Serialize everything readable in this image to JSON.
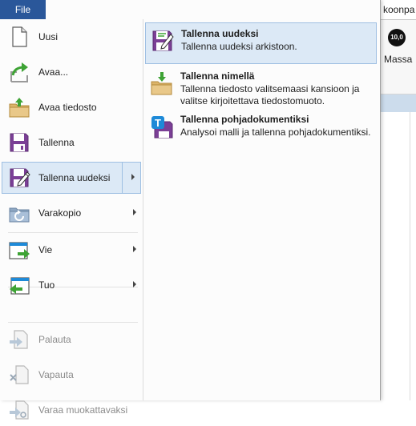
{
  "background_app": {
    "tab_partial": "koonpa",
    "ribbon_button_label": "Massa",
    "ribbon_button_icon_text": "10,0"
  },
  "file_tab": {
    "label": "File"
  },
  "menu": {
    "items": [
      {
        "label": "Uusi",
        "icon": "new-document-icon"
      },
      {
        "label": "Avaa...",
        "icon": "open-arrow-icon"
      },
      {
        "label": "Avaa tiedosto",
        "icon": "open-folder-icon"
      },
      {
        "label": "Tallenna",
        "icon": "save-disk-icon"
      },
      {
        "label": "Tallenna uudeksi",
        "icon": "save-as-new-icon",
        "selected": true,
        "has_submenu": true
      },
      {
        "label": "Varakopio",
        "icon": "backup-folder-icon",
        "has_submenu": true
      },
      {
        "label": "Vie",
        "icon": "export-icon",
        "has_submenu": true
      },
      {
        "label": "Tuo",
        "icon": "import-icon",
        "has_submenu": true
      },
      {
        "label": "Palauta",
        "icon": "restore-icon",
        "disabled": true
      },
      {
        "label": "Vapauta",
        "icon": "release-icon",
        "disabled": true
      },
      {
        "label": "Varaa muokattavaksi",
        "icon": "reserve-edit-icon",
        "disabled": true
      }
    ]
  },
  "submenu": {
    "items": [
      {
        "title": "Tallenna uudeksi",
        "description": "Tallenna uudeksi arkistoon.",
        "icon": "save-as-new-icon",
        "selected": true
      },
      {
        "title": "Tallenna nimellä",
        "description": "Tallenna tiedosto valitsemaasi kansioon ja valitse kirjoitettava tiedostomuoto.",
        "icon": "save-to-folder-icon"
      },
      {
        "title": "Tallenna pohjadokumentiksi",
        "description": "Analysoi malli ja tallenna pohjadokumentiksi.",
        "icon": "save-template-icon",
        "icon_letter": "T"
      }
    ]
  },
  "colors": {
    "file_tab": "#2a579a",
    "selection_bg": "#dce9f6",
    "selection_border": "#9ebfe2",
    "disk_purple": "#7b3f96",
    "folder_tan": "#dcb46a",
    "arrow_green": "#3ea335",
    "template_blue": "#1e8ad8"
  }
}
